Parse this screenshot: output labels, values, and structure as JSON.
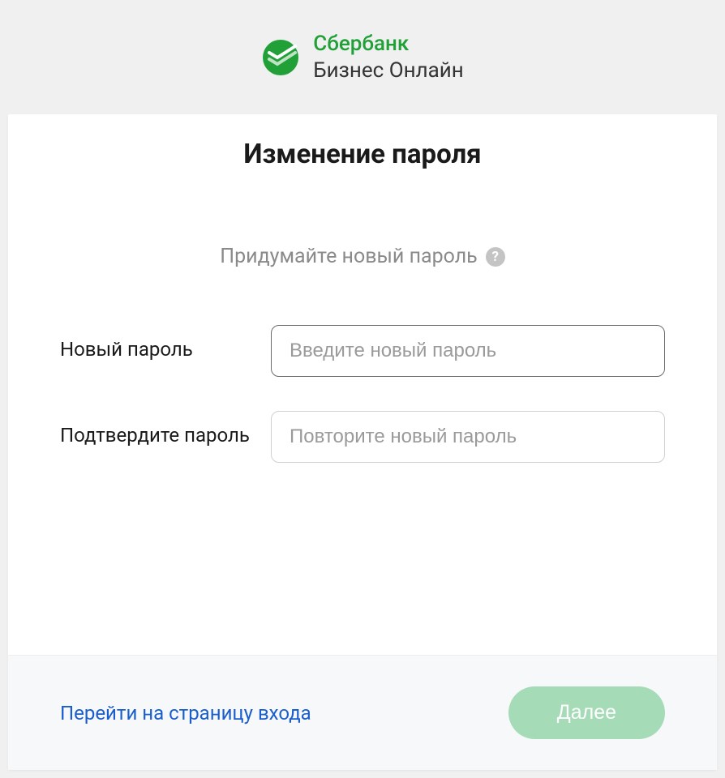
{
  "header": {
    "brand_line1": "Сбербанк",
    "brand_line2": "Бизнес Онлайн"
  },
  "page": {
    "title": "Изменение пароля",
    "hint": "Придумайте новый пароль"
  },
  "form": {
    "new_password": {
      "label": "Новый пароль",
      "placeholder": "Введите новый пароль",
      "value": ""
    },
    "confirm_password": {
      "label": "Подтвердите пароль",
      "placeholder": "Повторите новый пароль",
      "value": ""
    }
  },
  "footer": {
    "back_link": "Перейти на страницу входа",
    "next_button": "Далее"
  },
  "colors": {
    "brand_green": "#21a038",
    "link_blue": "#1a5dcc",
    "button_green_disabled": "#a5dbb6"
  }
}
